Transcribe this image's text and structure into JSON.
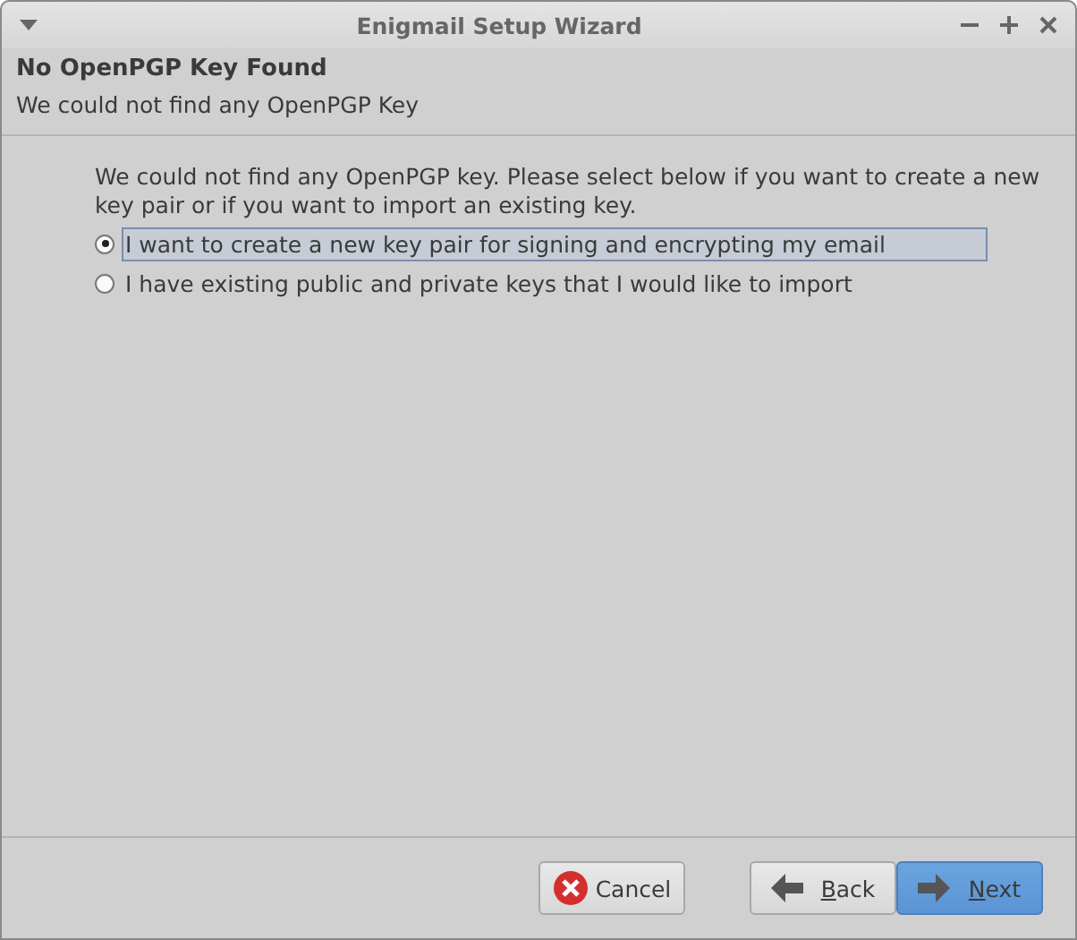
{
  "window": {
    "title": "Enigmail Setup Wizard"
  },
  "header": {
    "title": "No OpenPGP Key Found",
    "subtitle": "We could not find any OpenPGP Key"
  },
  "description": "We could not find any OpenPGP key. Please select below if you want to create a new key pair or if you want to import an existing key.",
  "options": [
    {
      "label": "I want to create a new key pair for signing and encrypting my email",
      "selected": true
    },
    {
      "label": "I have existing public and private keys that I would like to import",
      "selected": false
    }
  ],
  "buttons": [
    {
      "kind": "cancel",
      "rest": "Cancel",
      "default": false
    },
    {
      "kind": "back",
      "access": "B",
      "rest": "ack",
      "default": false
    },
    {
      "kind": "next",
      "access": "N",
      "rest": "ext",
      "default": true
    }
  ]
}
